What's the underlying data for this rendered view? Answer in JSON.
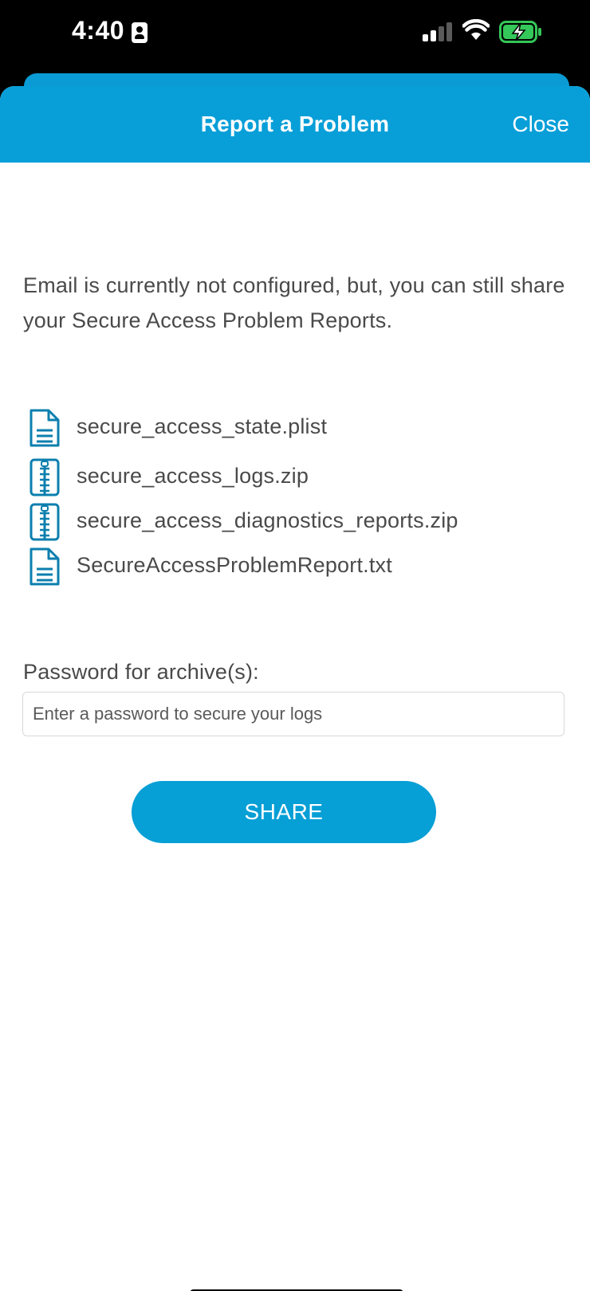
{
  "status_bar": {
    "time": "4:40",
    "contact_icon": "person-badge-icon",
    "signal_icon": "cellular-signal-icon",
    "wifi_icon": "wifi-icon",
    "battery_icon": "battery-charging-icon",
    "battery_color": "#34c759"
  },
  "header": {
    "title": "Report a Problem",
    "close_label": "Close",
    "background_color": "#089fd8"
  },
  "message": "Email is currently not configured, but, you can still share your Secure Access Problem Reports.",
  "files": [
    {
      "name": "secure_access_state.plist",
      "icon": "document-icon"
    },
    {
      "name": "secure_access_logs.zip",
      "icon": "zip-archive-icon"
    },
    {
      "name": "secure_access_diagnostics_reports.zip",
      "icon": "zip-archive-icon"
    },
    {
      "name": "SecureAccessProblemReport.txt",
      "icon": "document-icon"
    }
  ],
  "password": {
    "label": "Password for archive(s):",
    "value": "",
    "placeholder": "Enter a password to secure your logs"
  },
  "share_button": {
    "label": "SHARE",
    "color": "#069fd6"
  },
  "icon_color": "#0b7fae"
}
